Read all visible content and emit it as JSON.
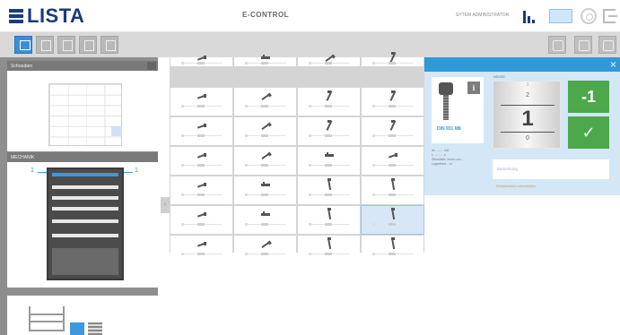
{
  "header": {
    "logo": "LISTA",
    "title": "E-CONTROL",
    "user": "SYTEM ADMINISTRATOR"
  },
  "icons": {
    "topbar": [
      "bar-chart-icon",
      "keyboard-icon",
      "settings-icon",
      "logout-icon"
    ],
    "toolbar_left": [
      "inventory-icon",
      "list-icon",
      "columns-icon",
      "document-icon",
      "image-icon"
    ],
    "toolbar_right": [
      "search-icon",
      "undo-icon",
      "home-icon"
    ]
  },
  "colors": {
    "brand": "#1d3a7a",
    "accent": "#3b8ed8",
    "panel_header": "#2f9ad9",
    "success": "#4ca84a"
  },
  "sidebar": {
    "section1_title": "Schrauben",
    "section2_title": "MECHANIK",
    "cabinet_left_num": "1",
    "cabinet_right_num": "1"
  },
  "grid": {
    "rows": 7,
    "cols": 4,
    "selected": [
      5,
      3
    ],
    "cells": [
      [
        "a",
        "b",
        "c",
        "d"
      ],
      [
        "a",
        "c",
        "d",
        "d"
      ],
      [
        "a",
        "c",
        "d",
        "d"
      ],
      [
        "a",
        "c",
        "b",
        "a"
      ],
      [
        "a",
        "b",
        "e",
        "e"
      ],
      [
        "a",
        "b",
        "e",
        "e"
      ],
      [
        "a",
        "c",
        "e",
        "e"
      ]
    ]
  },
  "panel": {
    "close": "×",
    "info": "i",
    "article_name": "DIN 931 M8",
    "properties": [
      "d1 ........ m8",
      "L .......... x",
      "Stückliste: xxxxx xxx...",
      "Lagerbest... xl"
    ],
    "counter_label": "MENGE",
    "counter_above2": "3",
    "counter_above1": "2",
    "counter_value": "1",
    "counter_below": "0",
    "minus": "-1",
    "check": "✓",
    "remark_placeholder": "Bemerkung",
    "warning": "Meldebestand unterschritten"
  }
}
